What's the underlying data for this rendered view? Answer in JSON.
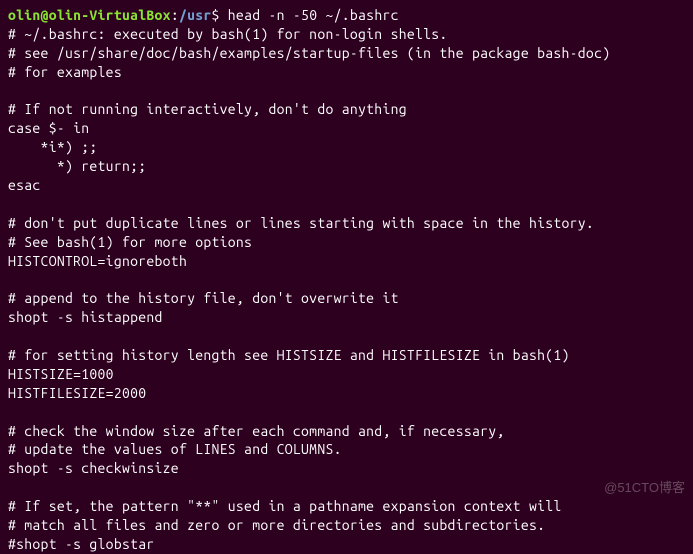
{
  "prompt": {
    "user_host": "olin@olin-VirtualBox",
    "separator": ":",
    "path": "/usr",
    "dollar": "$",
    "command": "head -n -50 ~/.bashrc"
  },
  "output": [
    "# ~/.bashrc: executed by bash(1) for non-login shells.",
    "# see /usr/share/doc/bash/examples/startup-files (in the package bash-doc)",
    "# for examples",
    "",
    "# If not running interactively, don't do anything",
    "case $- in",
    "    *i*) ;;",
    "      *) return;;",
    "esac",
    "",
    "# don't put duplicate lines or lines starting with space in the history.",
    "# See bash(1) for more options",
    "HISTCONTROL=ignoreboth",
    "",
    "# append to the history file, don't overwrite it",
    "shopt -s histappend",
    "",
    "# for setting history length see HISTSIZE and HISTFILESIZE in bash(1)",
    "HISTSIZE=1000",
    "HISTFILESIZE=2000",
    "",
    "# check the window size after each command and, if necessary,",
    "# update the values of LINES and COLUMNS.",
    "shopt -s checkwinsize",
    "",
    "# If set, the pattern \"**\" used in a pathname expansion context will",
    "# match all files and zero or more directories and subdirectories.",
    "#shopt -s globstar"
  ],
  "watermark": "@51CTO博客"
}
